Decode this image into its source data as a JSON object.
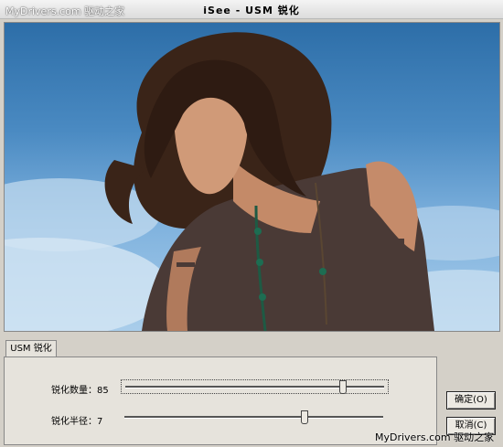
{
  "window": {
    "title": "iSee - USM 锐化",
    "watermark_top": "MyDrivers.com 驱动之家",
    "watermark_bottom": "MyDrivers.com 驱动之家"
  },
  "tabs": [
    {
      "label": "USM 锐化",
      "active": true
    }
  ],
  "sliders": [
    {
      "label": "锐化数量：",
      "value": "85",
      "level": 0.85
    },
    {
      "label": "锐化半径：",
      "value": "7",
      "level": 0.7
    }
  ],
  "buttons": {
    "ok": "确定(O)",
    "cancel": "取消(C)"
  },
  "colors": {
    "window_bg": "#d4d0c8",
    "panel_bg": "#e6e3dc",
    "sky": "#4a8ac2"
  }
}
